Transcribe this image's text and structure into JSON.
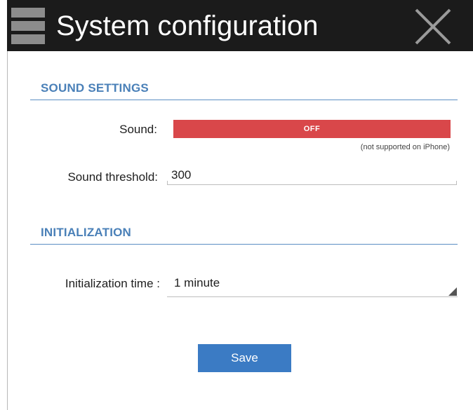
{
  "header": {
    "title": "System configuration",
    "menu_icon": "hamburger-menu-icon",
    "close_icon": "close-x-icon"
  },
  "sound_settings": {
    "section_title": "SOUND SETTINGS",
    "sound_label": "Sound:",
    "sound_state": "OFF",
    "sound_note": "(not supported on iPhone)",
    "threshold_label": "Sound threshold:",
    "threshold_value": "300"
  },
  "initialization": {
    "section_title": "INITIALIZATION",
    "time_label": "Initialization time :",
    "time_selected": "1 minute"
  },
  "actions": {
    "save_label": "Save"
  },
  "colors": {
    "header_bg": "#1b1b1b",
    "accent_blue": "#4a80b8",
    "toggle_off_red": "#d9474a",
    "button_blue": "#3b7bc4"
  }
}
